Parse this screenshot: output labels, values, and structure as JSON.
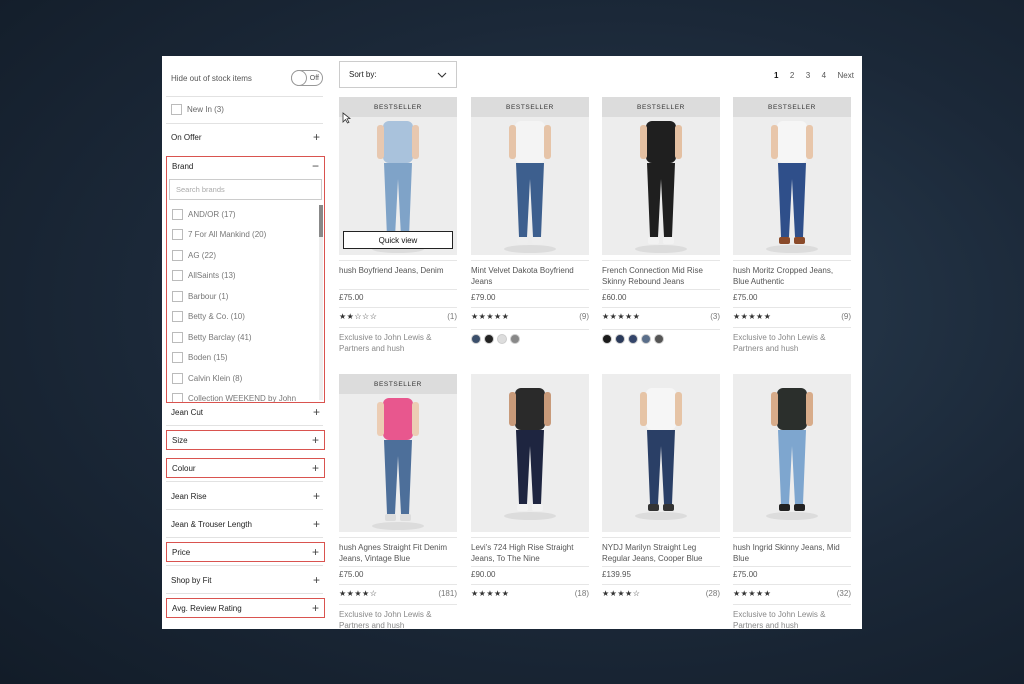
{
  "sidebar": {
    "hide_out_of_stock": "Hide out of stock items",
    "toggle_label": "Off",
    "new_in": "New In (3)",
    "facets_top": [
      "On Offer"
    ],
    "brand": {
      "title": "Brand",
      "search_placeholder": "Search brands",
      "items": [
        "AND/OR (17)",
        "7 For All Mankind (20)",
        "AG (22)",
        "AllSaints (13)",
        "Barbour (1)",
        "Betty & Co. (10)",
        "Betty Barclay (41)",
        "Boden (15)",
        "Calvin Klein (8)",
        "Collection WEEKEND by John"
      ]
    },
    "facets": [
      "Jean Cut",
      "Size",
      "Colour",
      "Jean Rise",
      "Jean & Trouser Length",
      "Price",
      "Shop by Fit",
      "Avg. Review Rating"
    ]
  },
  "toolbar": {
    "sort_label": "Sort by:",
    "pages": [
      "1",
      "2",
      "3",
      "4"
    ],
    "next": "Next"
  },
  "products": [
    {
      "badge": "BESTSELLER",
      "quick_view": "Quick view",
      "name": "hush Boyfriend Jeans, Denim",
      "price": "£75.00",
      "stars": "★★☆☆☆",
      "reviews": "(1)",
      "note": "Exclusive to John Lewis & Partners and hush"
    },
    {
      "badge": "BESTSELLER",
      "name": "Mint Velvet Dakota Boyfriend Jeans",
      "price": "£79.00",
      "stars": "★★★★★",
      "reviews": "(9)",
      "swatches": [
        "#3b4f6b",
        "#222222",
        "#dddddd",
        "#888888"
      ]
    },
    {
      "badge": "BESTSELLER",
      "name": "French Connection Mid Rise Skinny Rebound Jeans",
      "price": "£60.00",
      "stars": "★★★★★",
      "reviews": "(3)",
      "swatches": [
        "#1a1a1a",
        "#2b3a5a",
        "#34456a",
        "#5a6e8a",
        "#555555"
      ]
    },
    {
      "badge": "BESTSELLER",
      "name": "hush Moritz Cropped Jeans, Blue Authentic",
      "price": "£75.00",
      "stars": "★★★★★",
      "reviews": "(9)",
      "note": "Exclusive to John Lewis & Partners and hush"
    },
    {
      "badge": "BESTSELLER",
      "name": "hush Agnes Straight Fit Denim Jeans, Vintage Blue",
      "price": "£75.00",
      "stars": "★★★★☆",
      "reviews": "(181)",
      "note": "Exclusive to John Lewis & Partners and hush"
    },
    {
      "name": "Levi's 724 High Rise Straight Jeans, To The Nine",
      "price": "£90.00",
      "stars": "★★★★★",
      "reviews": "(18)"
    },
    {
      "name": "NYDJ Marilyn Straight Leg Regular Jeans, Cooper Blue",
      "price": "£139.95",
      "stars": "★★★★☆",
      "reviews": "(28)"
    },
    {
      "name": "hush Ingrid Skinny Jeans, Mid Blue",
      "price": "£75.00",
      "stars": "★★★★★",
      "reviews": "(32)",
      "note": "Exclusive to John Lewis & Partners and hush"
    }
  ],
  "figures": [
    {
      "top": "#a9c2dc",
      "jeans": "#7fa3c8",
      "skin": "#e8c8b0",
      "shoe": "#dddddd"
    },
    {
      "top": "#f4f4f4",
      "jeans": "#3d5f8e",
      "skin": "#e6c4a8",
      "shoe": "#eeeeee"
    },
    {
      "top": "#1f1f1f",
      "jeans": "#1f1f1f",
      "skin": "#e4c0a2",
      "shoe": "#f2f2f2"
    },
    {
      "top": "#f6f6f6",
      "jeans": "#2f4f8a",
      "skin": "#e8c6aa",
      "shoe": "#8a4a2a"
    },
    {
      "top": "#e8578e",
      "jeans": "#4d6f9a",
      "skin": "#eccdb4",
      "shoe": "#dddddd"
    },
    {
      "top": "#2a2a2a",
      "jeans": "#1e2540",
      "skin": "#c89a7a",
      "shoe": "#f2f2f2"
    },
    {
      "top": "#f6f6f6",
      "jeans": "#2a3f66",
      "skin": "#e6c4a6",
      "shoe": "#333333"
    },
    {
      "top": "#2b2f2c",
      "jeans": "#7ea6cf",
      "skin": "#d8ac8a",
      "shoe": "#222222"
    }
  ]
}
